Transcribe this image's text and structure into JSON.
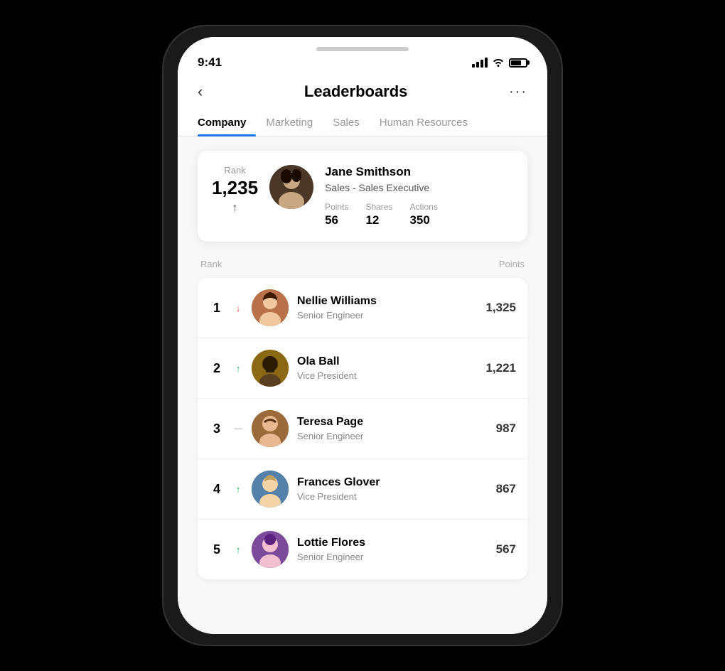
{
  "status": {
    "time": "9:41",
    "battery_level": 70
  },
  "header": {
    "title": "Leaderboards",
    "back_label": "‹",
    "more_label": "···"
  },
  "tabs": [
    {
      "id": "company",
      "label": "Company",
      "active": true
    },
    {
      "id": "marketing",
      "label": "Marketing",
      "active": false
    },
    {
      "id": "sales",
      "label": "Sales",
      "active": false
    },
    {
      "id": "hr",
      "label": "Human Resources",
      "active": false
    }
  ],
  "current_user": {
    "rank_label": "Rank",
    "rank": "1,235",
    "name": "Jane Smithson",
    "role": "Sales - Sales Executive",
    "stats": {
      "points_label": "Points",
      "points": "56",
      "shares_label": "Shares",
      "shares": "12",
      "actions_label": "Actions",
      "actions": "350"
    }
  },
  "list_header": {
    "rank_label": "Rank",
    "points_label": "Points"
  },
  "leaderboard": [
    {
      "rank": "1",
      "trend": "down",
      "trend_symbol": "↓",
      "name": "Nellie Williams",
      "role": "Senior Engineer",
      "points": "1,325",
      "avatar_color": "av-1"
    },
    {
      "rank": "2",
      "trend": "up",
      "trend_symbol": "↑",
      "name": "Ola Ball",
      "role": "Vice President",
      "points": "1,221",
      "avatar_color": "av-2"
    },
    {
      "rank": "3",
      "trend": "flat",
      "trend_symbol": "—",
      "name": "Teresa Page",
      "role": "Senior Engineer",
      "points": "987",
      "avatar_color": "av-3"
    },
    {
      "rank": "4",
      "trend": "up",
      "trend_symbol": "↑",
      "name": "Frances Glover",
      "role": "Vice President",
      "points": "867",
      "avatar_color": "av-4"
    },
    {
      "rank": "5",
      "trend": "up",
      "trend_symbol": "↑",
      "name": "Lottie Flores",
      "role": "Senior Engineer",
      "points": "567",
      "avatar_color": "av-5"
    }
  ]
}
